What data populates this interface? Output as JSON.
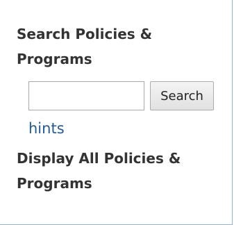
{
  "search": {
    "heading": "Search Policies & Programs",
    "input_value": "",
    "input_placeholder": "",
    "button_label": "Search",
    "hints_label": "hints"
  },
  "display_all": {
    "heading": "Display All Policies & Programs"
  },
  "colors": {
    "heading_text": "#333333",
    "link": "#1f5a9c",
    "panel_border": "#8db3e2"
  }
}
